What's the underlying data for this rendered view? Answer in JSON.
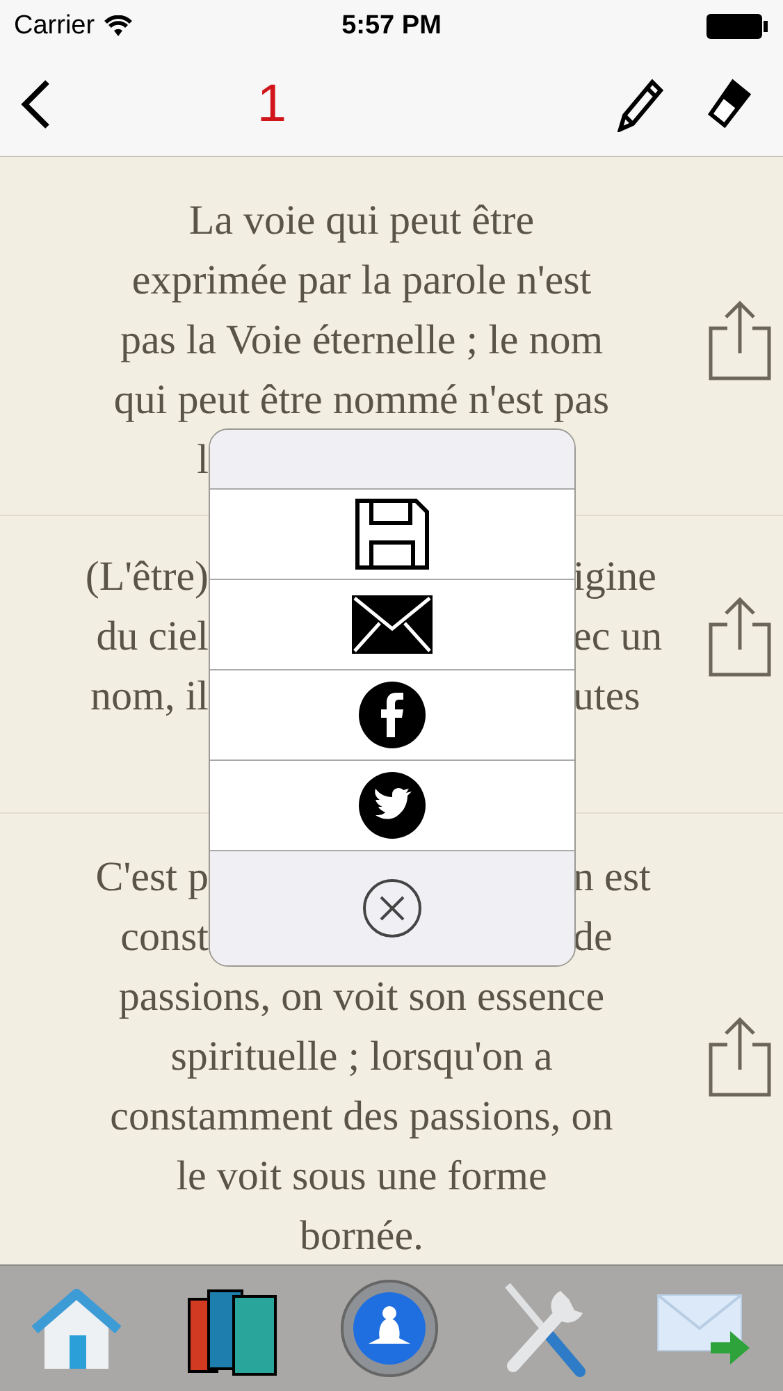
{
  "status_bar": {
    "carrier": "Carrier",
    "time": "5:57 PM"
  },
  "nav_bar": {
    "title": "1"
  },
  "paragraphs": [
    {
      "lines": [
        {
          "kind": "full",
          "text": "La voie qui peut être"
        },
        {
          "kind": "full",
          "text": "exprimée par la parole n'est"
        },
        {
          "kind": "full",
          "text": "pas la Voie éternelle ; le nom"
        },
        {
          "kind": "full",
          "text": "qui peut être nommé n'est pas"
        },
        {
          "kind": "split",
          "left": "l"
        }
      ]
    },
    {
      "lines": [
        {
          "kind": "split",
          "left": "(L'être)",
          "right": "igine"
        },
        {
          "kind": "split",
          "left": "du ciel",
          "right": "ec un"
        },
        {
          "kind": "split",
          "left": "nom, il",
          "right": "utes"
        }
      ]
    },
    {
      "lines": [
        {
          "kind": "split",
          "left": "C'est p",
          "right": "n est"
        },
        {
          "kind": "split",
          "left": "const",
          "right": "de"
        },
        {
          "kind": "full",
          "text": "passions, on voit son essence"
        },
        {
          "kind": "full",
          "text": "spirituelle ; lorsqu'on a"
        },
        {
          "kind": "full",
          "text": "constamment des passions, on"
        },
        {
          "kind": "full",
          "text": "le voit sous une forme"
        },
        {
          "kind": "full",
          "text": "bornée."
        }
      ]
    }
  ],
  "share_menu": {
    "items": [
      {
        "kind": "save"
      },
      {
        "kind": "mail"
      },
      {
        "kind": "facebook"
      },
      {
        "kind": "twitter"
      },
      {
        "kind": "cancel"
      }
    ]
  },
  "tab_bar": {
    "items": [
      {
        "kind": "home"
      },
      {
        "kind": "books"
      },
      {
        "kind": "meditation"
      },
      {
        "kind": "tools"
      },
      {
        "kind": "mail-forward"
      }
    ]
  }
}
